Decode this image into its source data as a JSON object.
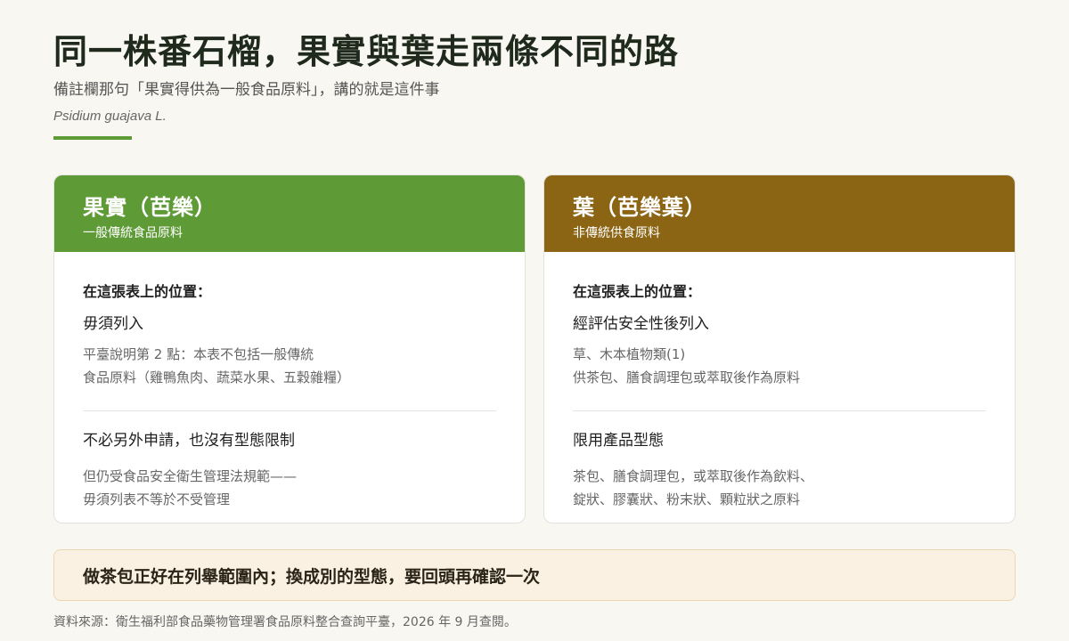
{
  "header": {
    "title": "同一株番石榴，果實與葉走兩條不同的路",
    "subtitle": "備註欄那句「果實得供為一般食品原料」，講的就是這件事",
    "latin_name": "Psidium guajava L.",
    "accent_color": "#5e9b36"
  },
  "cards": [
    {
      "title": "果實（芭樂）",
      "subtitle": "一般傳統食品原料",
      "color": "#5e9b36",
      "position_label": "在這張表上的位置：",
      "status": "毋須列入",
      "note_lines": [
        "平臺說明第 2 點：本表不包括一般傳統",
        "食品原料（雞鴨魚肉、蔬菜水果、五穀雜糧）"
      ],
      "point": "不必另外申請，也沒有型態限制",
      "point_note_lines": [
        "但仍受食品安全衛生管理法規範——",
        "毋須列表不等於不受管理"
      ]
    },
    {
      "title": "葉（芭樂葉）",
      "subtitle": "非傳統供食原料",
      "color": "#8b6414",
      "position_label": "在這張表上的位置：",
      "status": "經評估安全性後列入",
      "note_lines": [
        "草、木本植物類(1)",
        "供茶包、膳食調理包或萃取後作為原料"
      ],
      "point": "限用產品型態",
      "point_note_lines": [
        "茶包、膳食調理包，或萃取後作為飲料、",
        "錠狀、膠囊狀、粉末狀、顆粒狀之原料"
      ]
    }
  ],
  "callout": {
    "text": "做茶包正好在列舉範圍內；換成別的型態，要回頭再確認一次"
  },
  "footer": {
    "source": "資料來源：衛生福利部食品藥物管理署食品原料整合查詢平臺，2026 年 9 月查閱。"
  }
}
